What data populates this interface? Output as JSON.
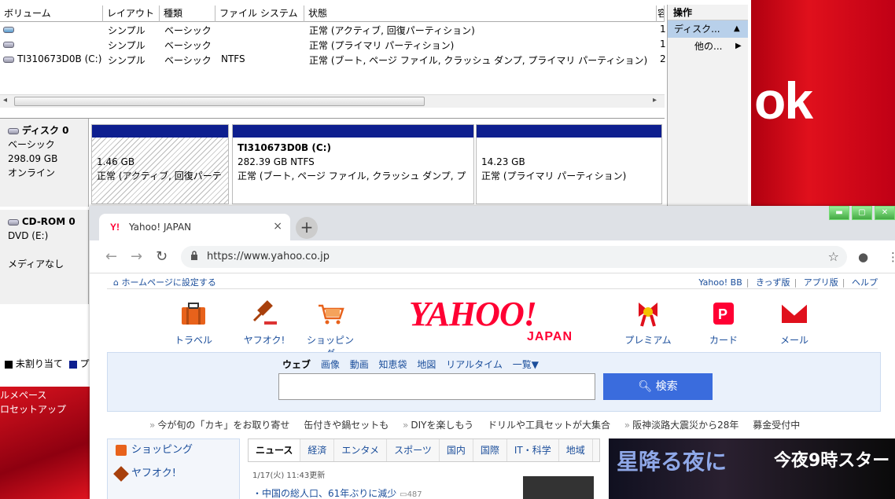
{
  "desktop": {
    "right_text": "ok",
    "left_text_1": "ルメペース",
    "left_text_2": "ロセットアップ"
  },
  "diskmgmt": {
    "columns": [
      "ボリューム",
      "レイアウト",
      "種類",
      "ファイル システム",
      "状態",
      "容"
    ],
    "volumes": [
      {
        "name": "",
        "layout": "シンプル",
        "type": "ベーシック",
        "fs": "",
        "status": "正常 (アクティブ, 回復パーティション)",
        "cap": "1"
      },
      {
        "name": "",
        "layout": "シンプル",
        "type": "ベーシック",
        "fs": "",
        "status": "正常 (プライマリ パーティション)",
        "cap": "1"
      },
      {
        "name": "TI310673D0B (C:)",
        "layout": "シンプル",
        "type": "ベーシック",
        "fs": "NTFS",
        "status": "正常 (ブート, ページ ファイル, クラッシュ ダンプ, プライマリ パーティション)",
        "cap": "2"
      }
    ],
    "actions": {
      "header": "操作",
      "item1": "ディスク...",
      "item2": "他の..."
    },
    "disk0": {
      "name": "ディスク 0",
      "type": "ベーシック",
      "size": "298.09 GB",
      "state": "オンライン"
    },
    "partitions": [
      {
        "title": "",
        "size": "1.46 GB",
        "status": "正常 (アクティブ, 回復パーテ"
      },
      {
        "title": "TI310673D0B  (C:)",
        "size": "282.39 GB NTFS",
        "status": "正常 (ブート, ページ ファイル, クラッシュ ダンプ, プ"
      },
      {
        "title": "",
        "size": "14.23 GB",
        "status": "正常 (プライマリ パーティション)"
      }
    ],
    "cdrom": {
      "name": "CD-ROM 0",
      "drive": "DVD (E:)",
      "media": "メディアなし"
    },
    "legend": {
      "unalloc": "未割り当て",
      "primary": "プ"
    }
  },
  "browser": {
    "tab_title": "Yahoo! JAPAN",
    "favicon": "Y!",
    "url": "https://www.yahoo.co.jp",
    "new_tab": "+",
    "close": "×"
  },
  "yahoo": {
    "set_home": "ホームページに設定する",
    "top_links": [
      "Yahoo! BB",
      "きっず版",
      "アプリ版",
      "ヘルプ"
    ],
    "services": [
      {
        "label": "トラベル",
        "icon": "suitcase-icon"
      },
      {
        "label": "ヤフオク!",
        "icon": "gavel-icon"
      },
      {
        "label": "ショッピング",
        "icon": "cart-icon"
      },
      {
        "label": "プレミアム",
        "icon": "ribbon-icon"
      },
      {
        "label": "カード",
        "icon": "card-icon"
      },
      {
        "label": "メール",
        "icon": "mail-icon"
      }
    ],
    "logo": "YAHOO!",
    "logo_sub": "JAPAN",
    "search_tabs": [
      "ウェブ",
      "画像",
      "動画",
      "知恵袋",
      "地図",
      "リアルタイム",
      "一覧▼"
    ],
    "search_btn": "検索",
    "promo": [
      "今が旬の「カキ」をお取り寄せ",
      "缶付きや鍋セットも",
      "DIYを楽しもう",
      "ドリルや工具セットが大集合",
      "阪神淡路大震災から28年",
      "募金受付中"
    ],
    "sidebar": [
      "ショッピング",
      "ヤフオク!"
    ],
    "news_tabs": [
      "ニュース",
      "経済",
      "エンタメ",
      "スポーツ",
      "国内",
      "国際",
      "IT・科学",
      "地域"
    ],
    "news_date": "1/17(火) 11:43更新",
    "news_item": "・中国の総人口、61年ぶりに減少",
    "news_count": "487",
    "ad_title": "星降る夜に",
    "ad_time": "今夜9時スター"
  }
}
